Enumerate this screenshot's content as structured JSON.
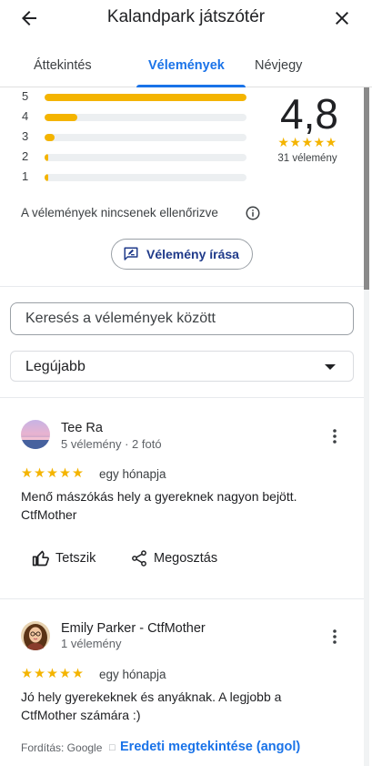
{
  "header": {
    "title": "Kalandpark játszótér",
    "back_icon": "arrow-left-icon",
    "close_icon": "close-icon"
  },
  "tabs": [
    {
      "label": "Áttekintés",
      "active": false
    },
    {
      "label": "Vélemények",
      "active": true
    },
    {
      "label": "Névjegy",
      "active": false
    }
  ],
  "rating_summary": {
    "score": "4,8",
    "stars": "★★★★★",
    "count_label": "31 vélemény",
    "distribution": [
      {
        "stars": "5",
        "fraction": 1.0
      },
      {
        "stars": "4",
        "fraction": 0.16
      },
      {
        "stars": "3",
        "fraction": 0.05
      },
      {
        "stars": "2",
        "fraction": 0.01
      },
      {
        "stars": "1",
        "fraction": 0.01
      }
    ],
    "bar_color": "#f4b400"
  },
  "notice": {
    "text": "A vélemények nincsenek ellenőrizve"
  },
  "write_review": {
    "label": "Vélemény írása"
  },
  "search": {
    "placeholder": "Keresés a vélemények között",
    "value": ""
  },
  "sort": {
    "selected": "Legújabb"
  },
  "reviews": [
    {
      "author": "Tee Ra",
      "meta": "5 vélemény · 2 fotó",
      "stars": "★★★★★",
      "date": "egy hónapja",
      "text": "Menő mászókás hely a gyereknek nagyon bejött. CtfMother",
      "actions": {
        "like": "Tetszik",
        "share": "Megosztás"
      }
    },
    {
      "author": "Emily Parker - CtfMother",
      "meta": "1 vélemény",
      "stars": "★★★★★",
      "date": "egy hónapja",
      "text": "Jó hely gyerekeknek és anyáknak. A legjobb a CtfMother számára :)",
      "translation": {
        "label": "Fordítás: Google",
        "separator": "□",
        "link": "Eredeti megtekintése (angol)"
      }
    }
  ],
  "colors": {
    "accent": "#1a73e8",
    "star": "#f4b400",
    "text": "#202124"
  }
}
